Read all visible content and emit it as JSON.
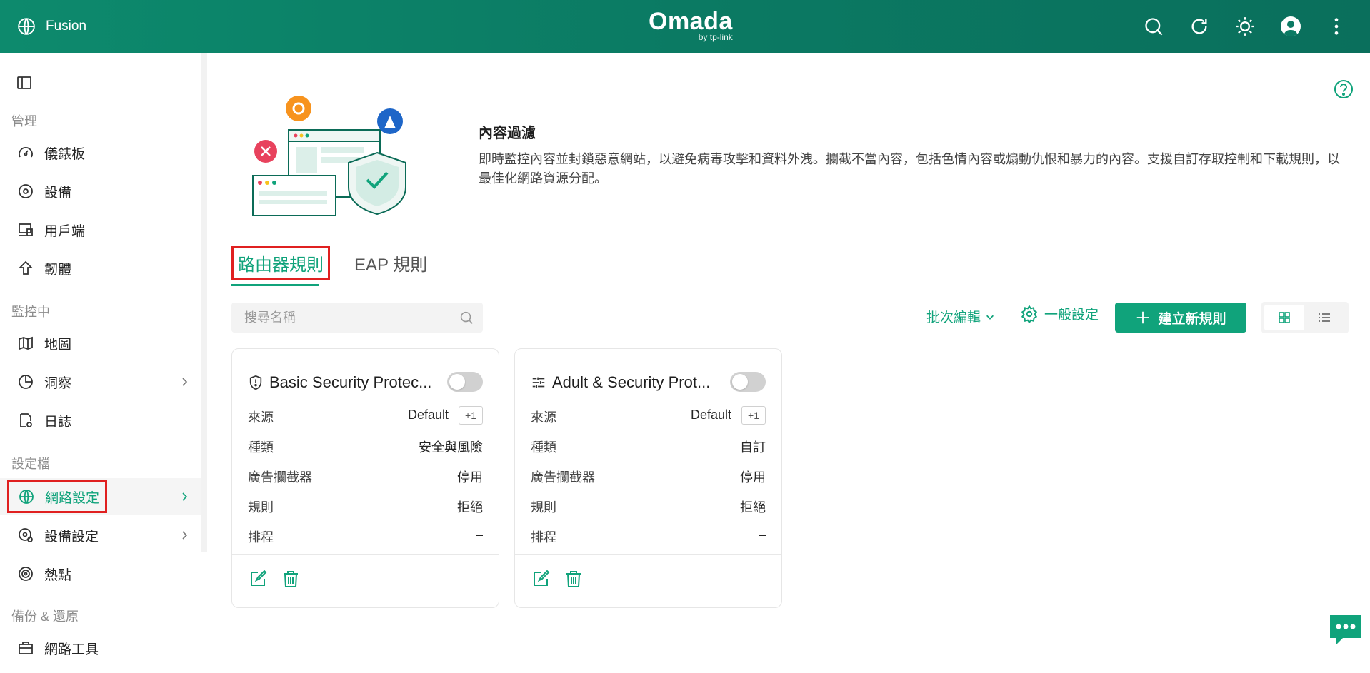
{
  "header": {
    "site_name": "Fusion",
    "brand_logo": "Omada",
    "brand_sub": "by tp-link",
    "icons": [
      "search-icon",
      "refresh-icon",
      "theme-icon",
      "avatar",
      "more-icon"
    ]
  },
  "sidebar": {
    "groups": {
      "manage": "管理",
      "monitor": "監控中",
      "config": "設定檔",
      "backup": "備份 & 還原"
    },
    "items": {
      "dashboard": "儀錶板",
      "devices": "設備",
      "clients": "用戶端",
      "firmware": "韌體",
      "map": "地圖",
      "insight": "洞察",
      "logs": "日誌",
      "network": "網路設定",
      "device_settings": "設備設定",
      "hotspot": "熱點",
      "tools": "網路工具"
    }
  },
  "intro": {
    "title": "內容過濾",
    "description": "即時監控內容並封鎖惡意網站，以避免病毒攻擊和資料外洩。攔截不當內容，包括色情內容或煽動仇恨和暴力的內容。支援自訂存取控制和下載規則，以最佳化網路資源分配。"
  },
  "tabs": {
    "router": "路由器規則",
    "eap": "EAP 規則"
  },
  "toolbar": {
    "search_placeholder": "搜尋名稱",
    "batch_edit": "批次編輯",
    "general_settings": "一般設定",
    "create_rule": "建立新規則"
  },
  "cards": [
    {
      "title": "Basic Security Protec...",
      "icon": "shield-icon",
      "rows": {
        "source_label": "來源",
        "source_value": "Default",
        "source_tag": "+1",
        "type_label": "種類",
        "type_value": "安全與風險",
        "adblock_label": "廣告攔截器",
        "adblock_value": "停用",
        "rule_label": "規則",
        "rule_value": "拒絕",
        "schedule_label": "排程",
        "schedule_value": "–"
      }
    },
    {
      "title": "Adult & Security Prot...",
      "icon": "sliders-icon",
      "rows": {
        "source_label": "來源",
        "source_value": "Default",
        "source_tag": "+1",
        "type_label": "種類",
        "type_value": "自訂",
        "adblock_label": "廣告攔截器",
        "adblock_value": "停用",
        "rule_label": "規則",
        "rule_value": "拒絕",
        "schedule_label": "排程",
        "schedule_value": "–"
      }
    }
  ],
  "colors": {
    "accent": "#10a37b",
    "header_bg": "#0b7a63",
    "highlight_box": "#e02020"
  }
}
